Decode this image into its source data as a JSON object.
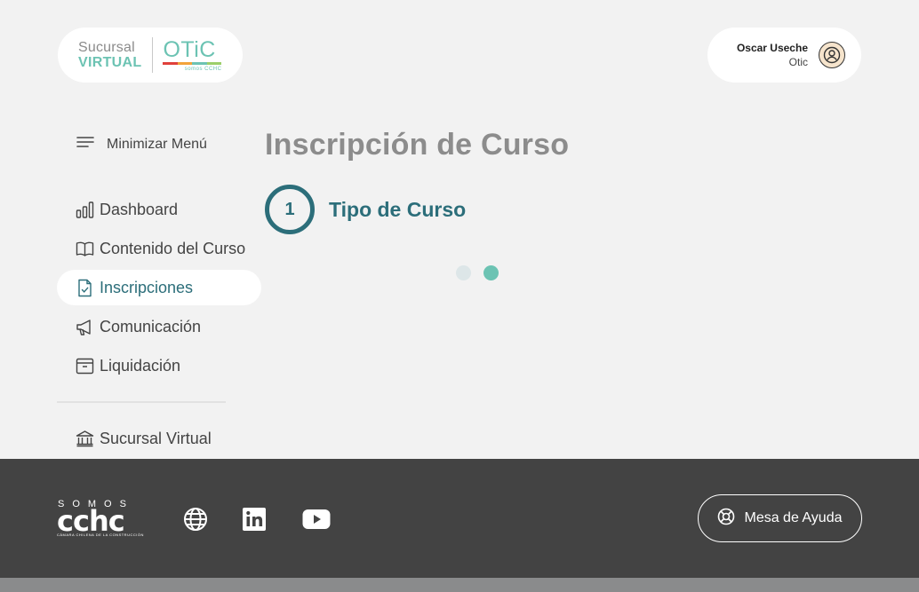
{
  "brand": {
    "sucursal_line1": "Sucursal",
    "sucursal_line2": "VIRTUAL",
    "otic_word": "OTiC",
    "otic_sub": "somos CCHC",
    "otic_bar_colors": [
      "#e0413b",
      "#f2a33a",
      "#6cc3b3",
      "#9ccf6a"
    ]
  },
  "user": {
    "name": "Oscar Useche",
    "role": "Otic",
    "avatar_icon": "user-circle-icon"
  },
  "sidebar": {
    "minimize_label": "Minimizar Menú",
    "items": [
      {
        "label": "Dashboard",
        "icon": "bar-chart-icon"
      },
      {
        "label": "Contenido del Curso",
        "icon": "open-book-icon"
      },
      {
        "label": "Inscripciones",
        "icon": "document-check-icon",
        "active": true
      },
      {
        "label": "Comunicación",
        "icon": "megaphone-icon"
      },
      {
        "label": "Liquidación",
        "icon": "archive-box-icon"
      }
    ],
    "bottom_items": [
      {
        "label": "Sucursal Virtual",
        "icon": "bank-building-icon"
      }
    ]
  },
  "main": {
    "title": "Inscripción de Curso",
    "step": {
      "number": "1",
      "label": "Tipo de Curso"
    }
  },
  "loader": {
    "dot_colors": [
      "#dde6e8",
      "#6cc3b3"
    ]
  },
  "footer": {
    "brand_top": "SOMOS",
    "brand_mark": "cchc",
    "brand_small": "CÁMARA CHILENA DE LA CONSTRUCCIÓN",
    "social": [
      "globe-icon",
      "linkedin-icon",
      "youtube-icon"
    ],
    "help_label": "Mesa de Ayuda",
    "help_icon": "lifebuoy-icon"
  },
  "colors": {
    "accent": "#2c6e7a",
    "teal": "#6cc3b3",
    "footer_bg": "#434343",
    "page_bg": "#f2f2f2"
  }
}
